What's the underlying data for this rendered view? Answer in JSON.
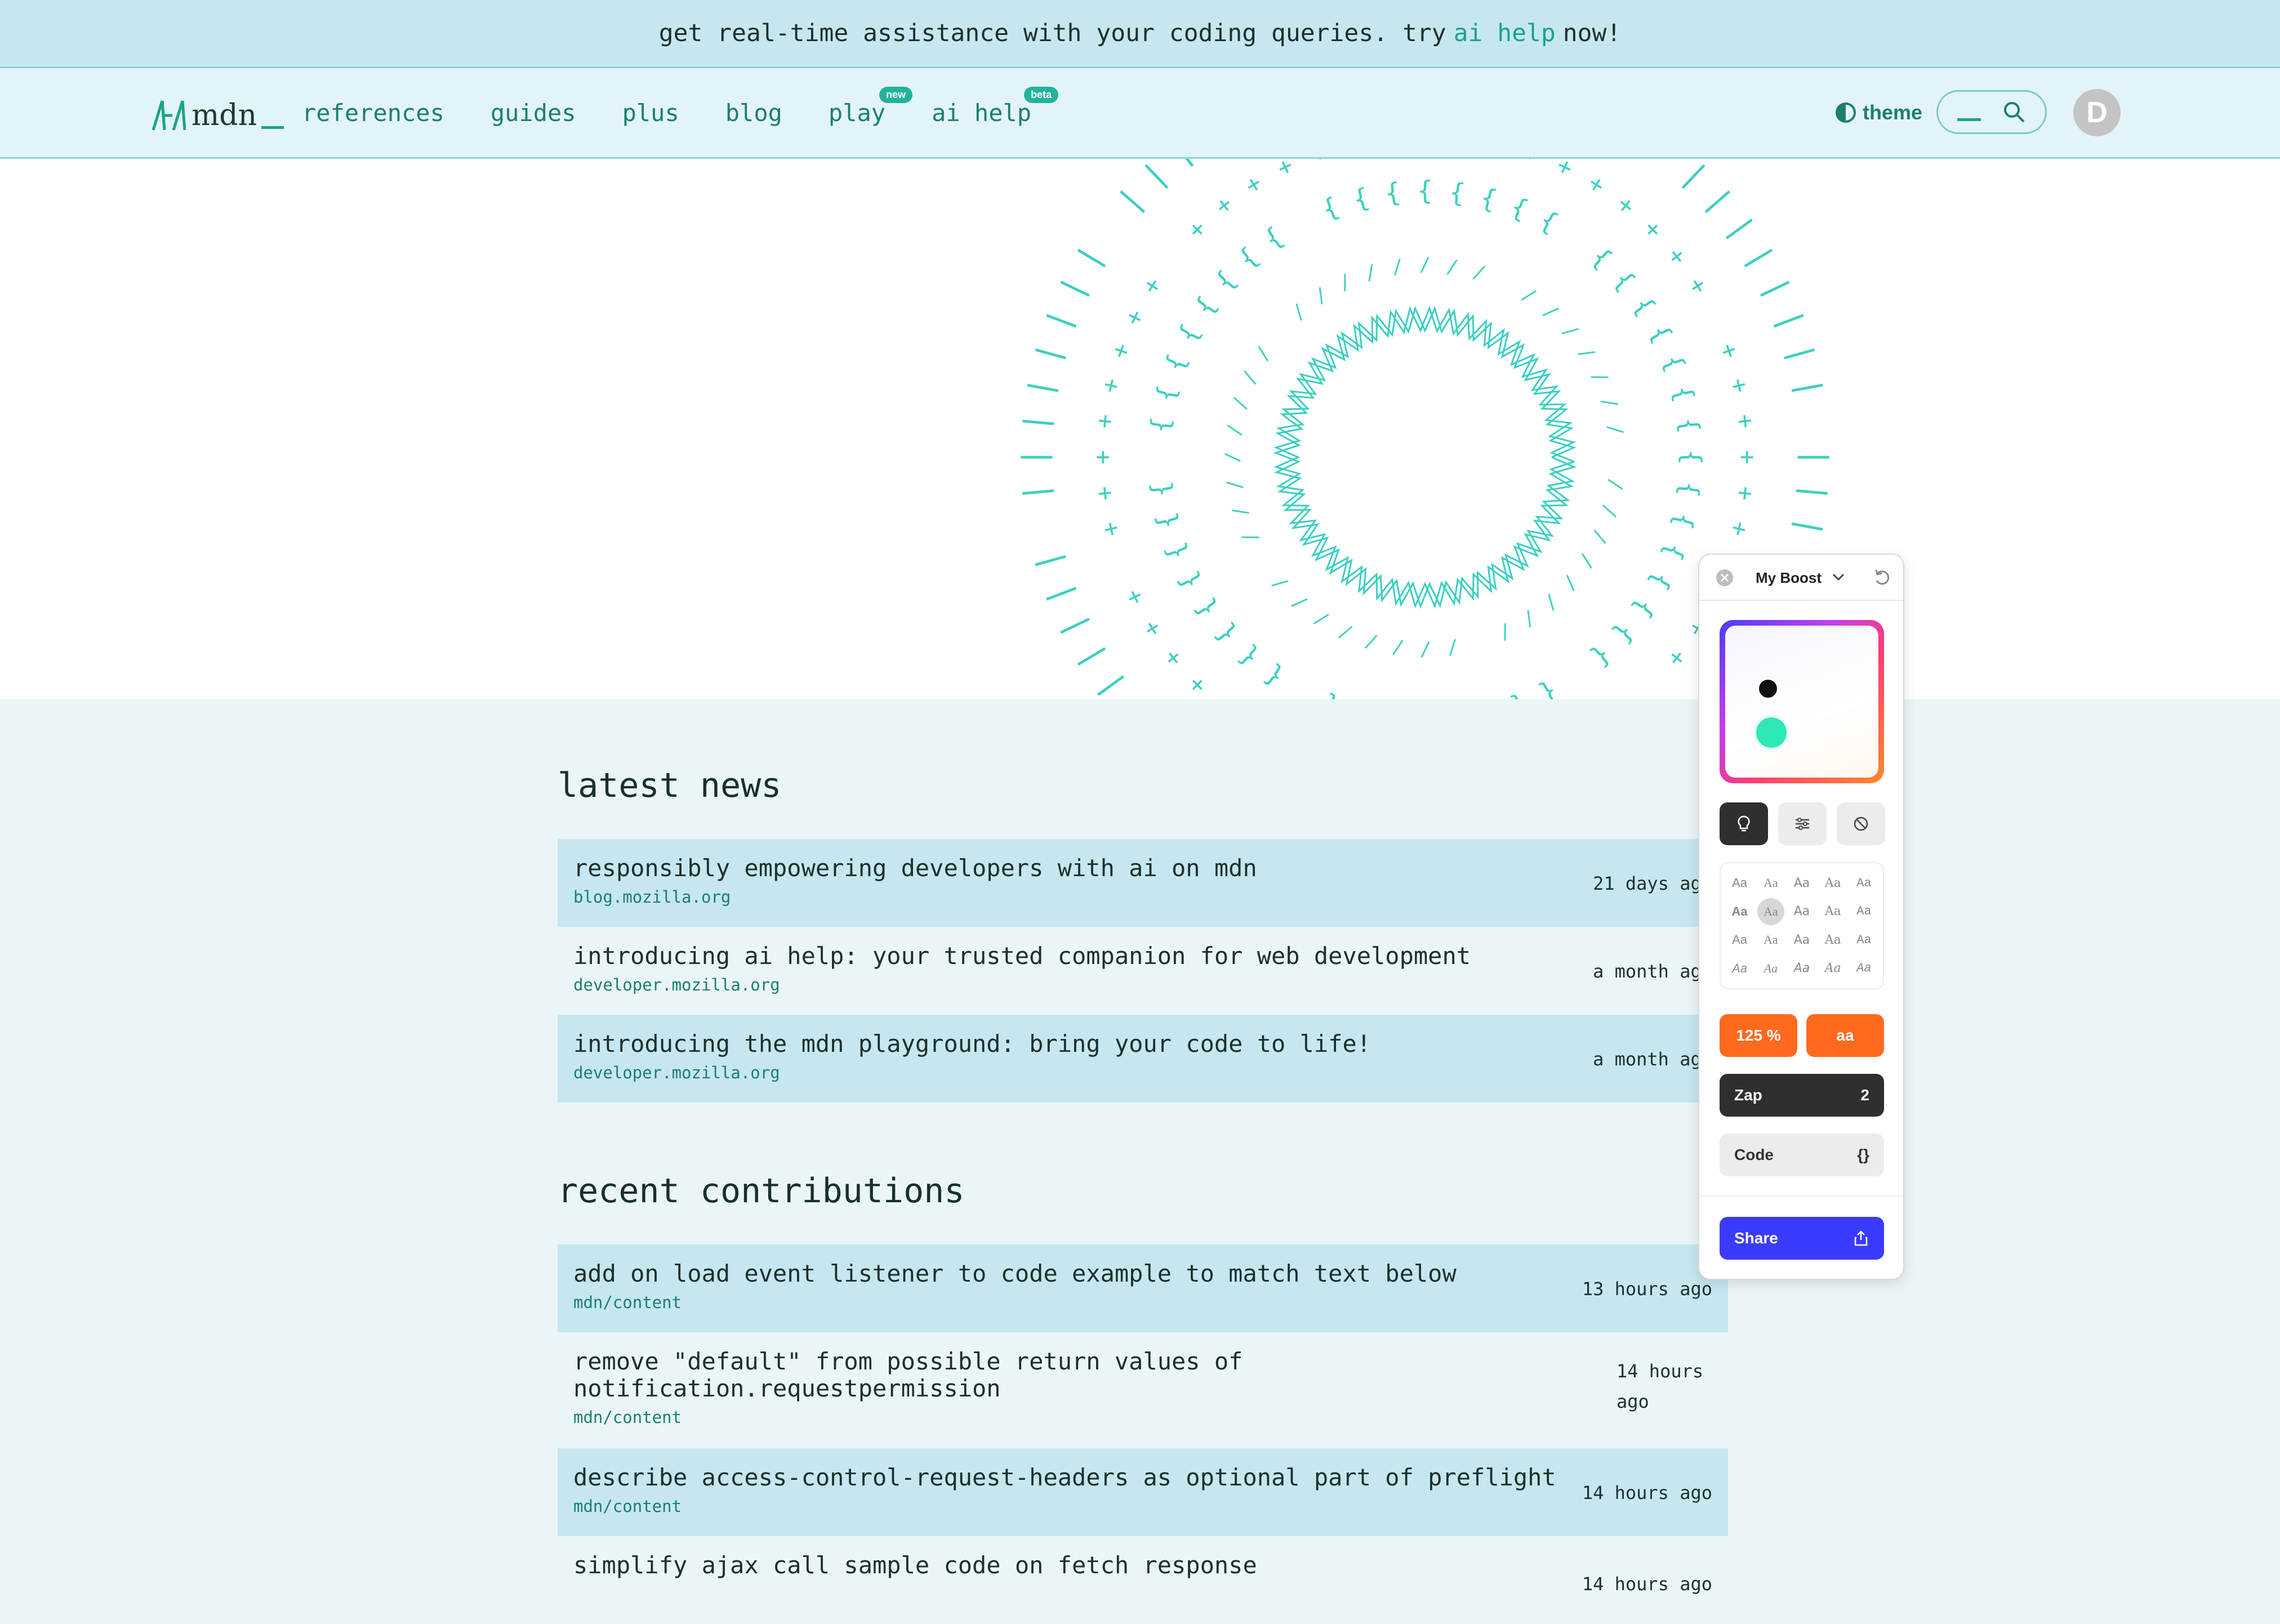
{
  "banner": {
    "text_before": "get real-time assistance with your coding queries. try",
    "link": "ai help",
    "text_after": "now!"
  },
  "header": {
    "logo_text": "mdn",
    "nav": [
      {
        "label": "references"
      },
      {
        "label": "guides"
      },
      {
        "label": "plus"
      },
      {
        "label": "blog"
      },
      {
        "label": "play",
        "badge": "new"
      },
      {
        "label": "ai help",
        "badge": "beta"
      }
    ],
    "theme_label": "theme",
    "avatar_initial": "D"
  },
  "latest_news": {
    "title": "latest news",
    "items": [
      {
        "title": "responsibly empowering developers with ai on mdn",
        "source": "blog.mozilla.org",
        "time": "21 days ago"
      },
      {
        "title": "introducing ai help: your trusted companion for web development",
        "source": "developer.mozilla.org",
        "time": "a month ago"
      },
      {
        "title": "introducing the mdn playground: bring your code to life!",
        "source": "developer.mozilla.org",
        "time": "a month ago"
      }
    ]
  },
  "recent_contributions": {
    "title": "recent contributions",
    "items": [
      {
        "title": "add on load event listener to code example to match text below",
        "source": "mdn/content",
        "time": "13 hours ago"
      },
      {
        "title": "remove \"default\" from possible return values of notification.requestpermission",
        "source": "mdn/content",
        "time": "14 hours ago"
      },
      {
        "title": "describe access-control-request-headers as optional part of preflight",
        "source": "mdn/content",
        "time": "14 hours ago"
      },
      {
        "title": "simplify ajax call sample code on fetch response",
        "source": "",
        "time": "14 hours ago"
      }
    ]
  },
  "boost_panel": {
    "title": "My Boost",
    "font_sample": "Aa",
    "size_label": "125 %",
    "case_label": "aa",
    "zap_label": "Zap",
    "zap_count": "2",
    "code_label": "Code",
    "code_glyph": "{}",
    "share_label": "Share",
    "colors": {
      "orange": "#ff6a1f",
      "share": "#3b3bff",
      "zap": "#2f2f2f",
      "teal_dot": "#2ee8b6"
    }
  },
  "colors": {
    "accent": "#1aa38b",
    "banner_bg": "#c6e7f0",
    "header_bg": "#e3f4f8",
    "row_alt": "#c6e7f0",
    "hero_glyph": "#3ccfc0"
  }
}
